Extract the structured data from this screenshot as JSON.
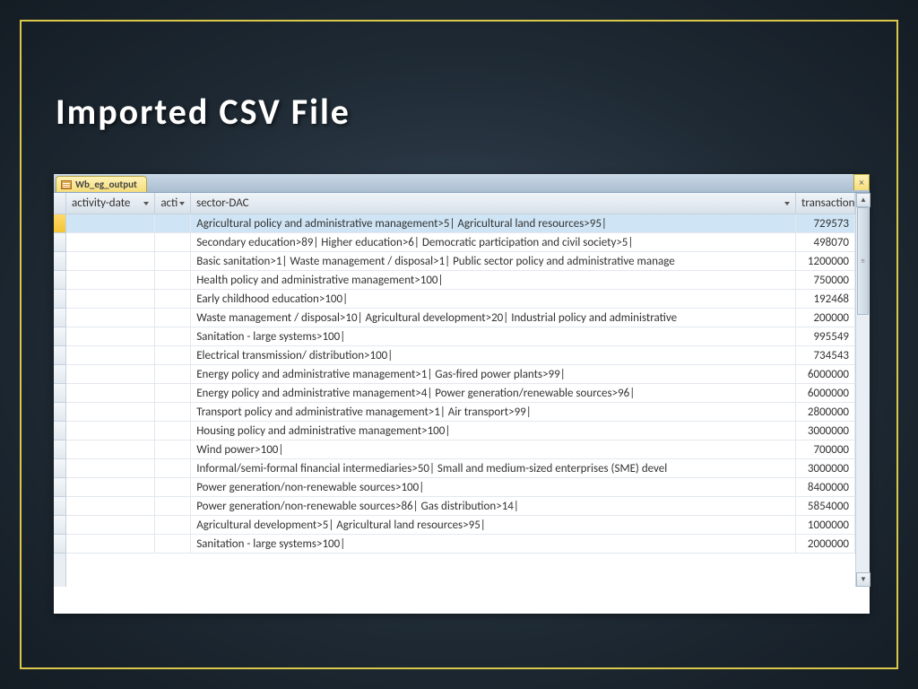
{
  "slide": {
    "title": "Imported CSV File"
  },
  "tab": {
    "name": "Wb_eg_output",
    "close": "×"
  },
  "columns": {
    "activity_date": "activity-date",
    "acti": "acti",
    "sector_dac": "sector-DAC",
    "transaction": "transaction-"
  },
  "rows": [
    {
      "date": "",
      "acti": "",
      "sector": "Agricultural policy and administrative management>5| Agricultural land resources>95|",
      "trans": "729573"
    },
    {
      "date": "",
      "acti": "",
      "sector": "Secondary education>89| Higher education>6| Democratic participation and civil society>5|",
      "trans": "498070"
    },
    {
      "date": "",
      "acti": "",
      "sector": "Basic sanitation>1| Waste management / disposal>1| Public sector policy and administrative manage",
      "trans": "1200000"
    },
    {
      "date": "",
      "acti": "",
      "sector": "Health policy and administrative management>100|",
      "trans": "750000"
    },
    {
      "date": "",
      "acti": "",
      "sector": "Early childhood education>100|",
      "trans": "192468"
    },
    {
      "date": "",
      "acti": "",
      "sector": "Waste management / disposal>10| Agricultural development>20| Industrial policy and administrative",
      "trans": "200000"
    },
    {
      "date": "",
      "acti": "",
      "sector": "Sanitation - large systems>100|",
      "trans": "995549"
    },
    {
      "date": "",
      "acti": "",
      "sector": "Electrical transmission/ distribution>100|",
      "trans": "734543"
    },
    {
      "date": "",
      "acti": "",
      "sector": "Energy policy and administrative management>1| Gas-fired power plants>99|",
      "trans": "6000000"
    },
    {
      "date": "",
      "acti": "",
      "sector": "Energy policy and administrative management>4| Power generation/renewable sources>96|",
      "trans": "6000000"
    },
    {
      "date": "",
      "acti": "",
      "sector": "Transport policy and administrative management>1| Air transport>99|",
      "trans": "2800000"
    },
    {
      "date": "",
      "acti": "",
      "sector": "Housing policy and administrative management>100|",
      "trans": "3000000"
    },
    {
      "date": "",
      "acti": "",
      "sector": "Wind power>100|",
      "trans": "700000"
    },
    {
      "date": "",
      "acti": "",
      "sector": "Informal/semi-formal financial intermediaries>50| Small and medium-sized enterprises (SME) devel",
      "trans": "3000000"
    },
    {
      "date": "",
      "acti": "",
      "sector": "Power generation/non-renewable sources>100|",
      "trans": "8400000"
    },
    {
      "date": "",
      "acti": "",
      "sector": "Power generation/non-renewable sources>86| Gas distribution>14|",
      "trans": "5854000"
    },
    {
      "date": "",
      "acti": "",
      "sector": "Agricultural development>5| Agricultural land resources>95|",
      "trans": "1000000"
    },
    {
      "date": "",
      "acti": "",
      "sector": "Sanitation - large systems>100|",
      "trans": "2000000"
    }
  ]
}
